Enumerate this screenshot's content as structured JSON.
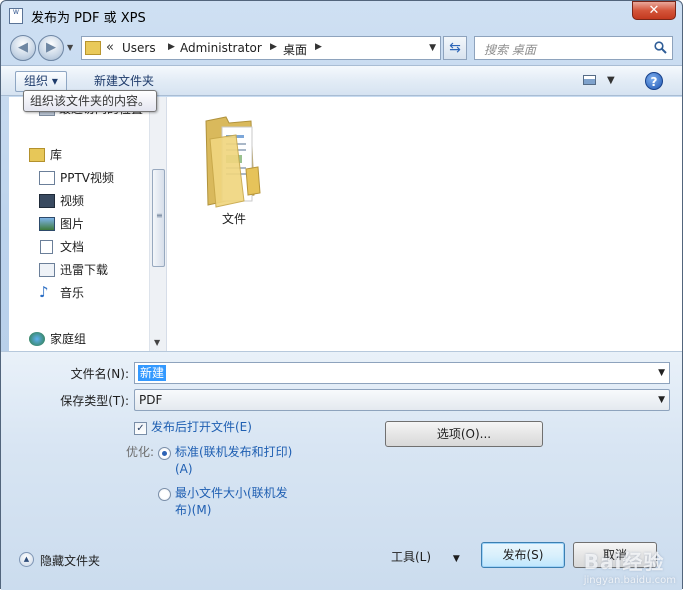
{
  "window": {
    "title": "发布为 PDF 或 XPS",
    "app_icon_text": "W",
    "close_label": "✕"
  },
  "navigation": {
    "back_icon": "back-arrow-icon",
    "forward_icon": "forward-arrow-icon",
    "address_prefix": "«",
    "breadcrumbs": [
      "Users",
      "Administrator",
      "桌面"
    ],
    "search_placeholder": "搜索 桌面"
  },
  "toolbar": {
    "organize_label": "组织 ▾",
    "new_folder_label": "新建文件夹",
    "help_label": "?",
    "tooltip": "组织该文件夹的内容。"
  },
  "sidebar": {
    "items": [
      {
        "label": "最近访问的位置",
        "icon": "recent-places-icon"
      },
      {
        "label": "库",
        "icon": "library-icon"
      },
      {
        "label": "PPTV视频",
        "icon": "video-library-icon"
      },
      {
        "label": "视频",
        "icon": "video-icon"
      },
      {
        "label": "图片",
        "icon": "pictures-icon"
      },
      {
        "label": "文档",
        "icon": "documents-icon"
      },
      {
        "label": "迅雷下载",
        "icon": "download-icon"
      },
      {
        "label": "音乐",
        "icon": "music-icon"
      },
      {
        "label": "家庭组",
        "icon": "homegroup-icon"
      }
    ]
  },
  "files": [
    {
      "name": "文件",
      "icon": "folder-icon"
    }
  ],
  "form": {
    "filename_label": "文件名(N):",
    "filename_value": "新建",
    "filetype_label": "保存类型(T):",
    "filetype_value": "PDF",
    "open_after_publish": {
      "label": "发布后打开文件(E)",
      "checked": true
    },
    "optimize_label": "优化:",
    "optimize_standard_line1": "标准(联机发布和打印)",
    "optimize_standard_line2": "(A)",
    "optimize_min_line1": "最小文件大小(联机发",
    "optimize_min_line2": "布)(M)",
    "options_button": "选项(O)..."
  },
  "footer": {
    "hide_folders_label": "隐藏文件夹",
    "tools_label": "工具(L)",
    "publish_button": "发布(S)",
    "cancel_button": "取消",
    "watermark_main": "Bai经验",
    "watermark_sub": "jingyan.baidu.com"
  },
  "colors": {
    "accent": "#3399ff",
    "link_text": "#1f5fb2",
    "chrome": "#cfe0f3"
  }
}
